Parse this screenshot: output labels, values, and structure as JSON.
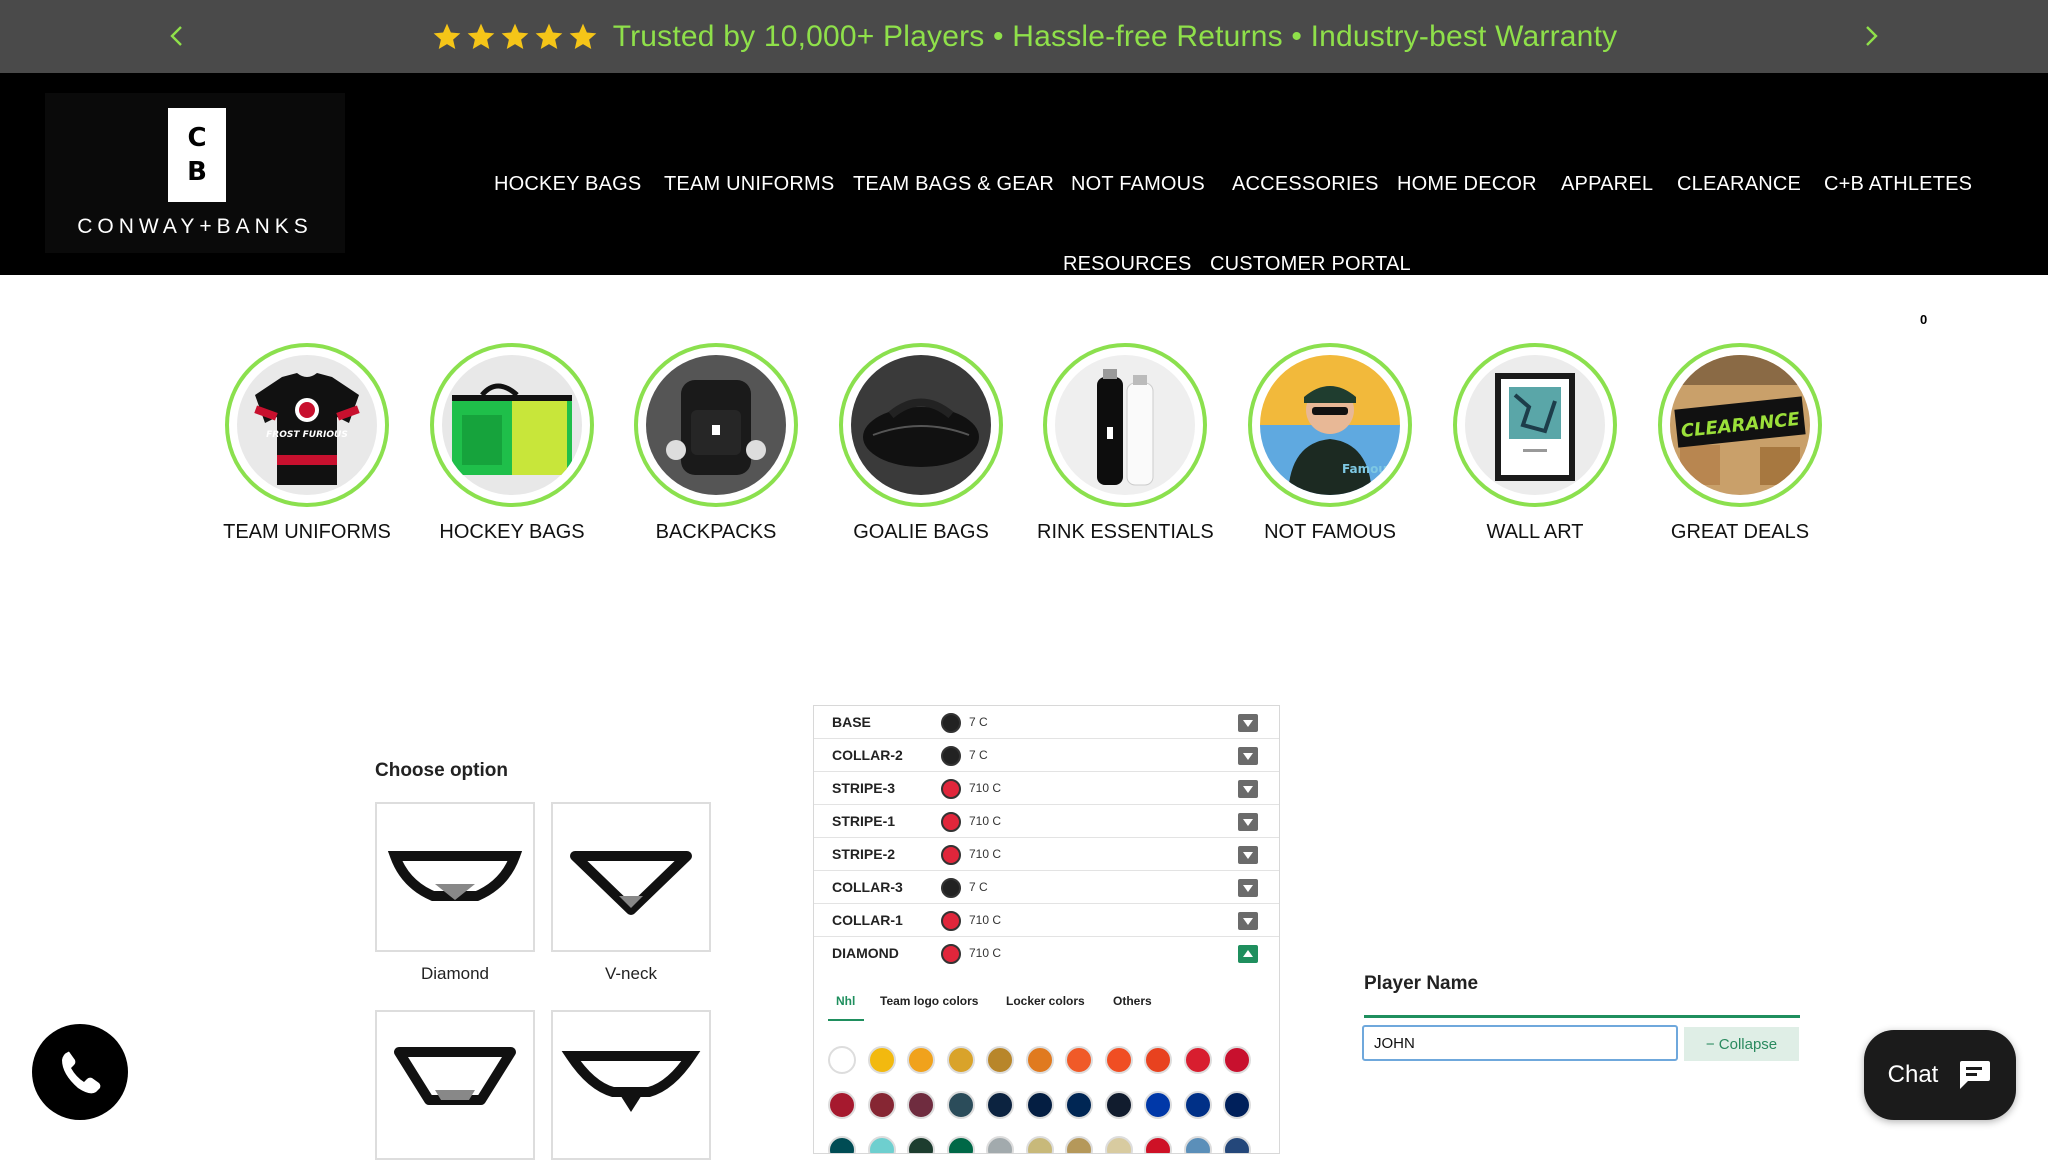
{
  "announcement": {
    "text": "Trusted by 10,000+ Players • Hassle-free Returns • Industry-best Warranty",
    "star_color": "#f5c518",
    "text_color": "#8fe04a"
  },
  "logo": {
    "tile_top": "C",
    "tile_bottom": "B",
    "wordmark": "CONWAY+BANKS"
  },
  "nav": {
    "row1": [
      "HOCKEY BAGS",
      "TEAM UNIFORMS",
      "TEAM BAGS & GEAR",
      "NOT FAMOUS",
      "ACCESSORIES",
      "HOME DECOR",
      "APPAREL",
      "CLEARANCE",
      "C+B ATHLETES"
    ],
    "row2": [
      "RESOURCES",
      "CUSTOMER PORTAL"
    ]
  },
  "cart": {
    "count": "0"
  },
  "categories": [
    {
      "label": "TEAM UNIFORMS"
    },
    {
      "label": "HOCKEY BAGS"
    },
    {
      "label": "BACKPACKS"
    },
    {
      "label": "GOALIE BAGS"
    },
    {
      "label": "RINK ESSENTIALS"
    },
    {
      "label": "NOT FAMOUS"
    },
    {
      "label": "WALL ART"
    },
    {
      "label": "GREAT DEALS"
    }
  ],
  "category_image_text": {
    "jersey": "FROST FURIOUS",
    "cap": "Famous",
    "clearance": "CLEARANCE"
  },
  "options": {
    "title": "Choose option",
    "items": [
      {
        "label": "Diamond"
      },
      {
        "label": "V-neck"
      },
      {
        "label": ""
      },
      {
        "label": ""
      }
    ]
  },
  "color_rows": [
    {
      "name": "BASE",
      "code": "7 C",
      "color": "#222222"
    },
    {
      "name": "COLLAR-2",
      "code": "7 C",
      "color": "#222222"
    },
    {
      "name": "STRIPE-3",
      "code": "710 C",
      "color": "#e0263b"
    },
    {
      "name": "STRIPE-1",
      "code": "710 C",
      "color": "#e0263b"
    },
    {
      "name": "STRIPE-2",
      "code": "710 C",
      "color": "#e0263b"
    },
    {
      "name": "COLLAR-3",
      "code": "7 C",
      "color": "#222222"
    },
    {
      "name": "COLLAR-1",
      "code": "710 C",
      "color": "#e0263b"
    },
    {
      "name": "DIAMOND",
      "code": "710 C",
      "color": "#e0263b"
    }
  ],
  "color_tabs": [
    "Nhl",
    "Team logo colors",
    "Locker colors",
    "Others"
  ],
  "swatches": [
    [
      "#ffffff",
      "#f2b90f",
      "#f0a21c",
      "#d9a32a",
      "#b8862a",
      "#e07a1f",
      "#f05a28",
      "#f04e23",
      "#e8421f",
      "#d81e2f",
      "#c8102e"
    ],
    [
      "#a6192e",
      "#862633",
      "#6f2c3f",
      "#2b4c5a",
      "#0c2340",
      "#041e42",
      "#002654",
      "#111c2e",
      "#0038a8",
      "#003087",
      "#00205b"
    ],
    [
      "#004c54",
      "#6ecfcf",
      "#1d3d2f",
      "#006847",
      "#a2aaad",
      "#c8b97a",
      "#b5985a",
      "#d8cba0",
      "#ce1126",
      "#5b8fb9",
      "#24477a"
    ]
  ],
  "player": {
    "title": "Player Name",
    "value": "JOHN",
    "collapse_label": "− Collapse"
  },
  "chat": {
    "label": "Chat"
  }
}
